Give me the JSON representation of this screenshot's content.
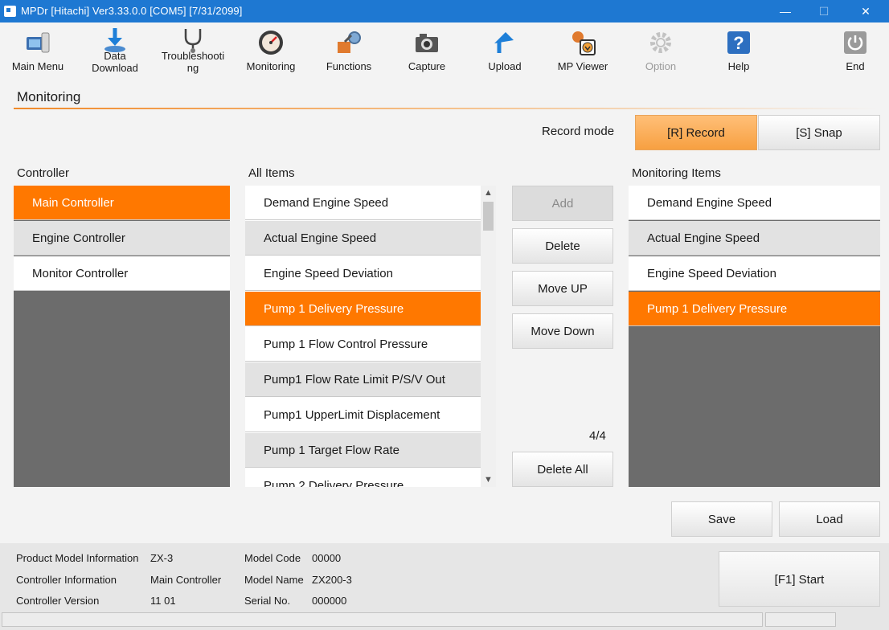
{
  "window": {
    "title": "MPDr [Hitachi]  Ver3.33.0.0 [COM5] [7/31/2099]",
    "minimize": "—",
    "maximize": "☐",
    "close": "✕"
  },
  "toolbar": {
    "items": [
      {
        "label": "Main Menu",
        "icon": "main-menu-icon"
      },
      {
        "label": "Data Download",
        "icon": "download-icon"
      },
      {
        "label": "Troubleshooting",
        "icon": "stethoscope-icon"
      },
      {
        "label": "Monitoring",
        "icon": "gauge-icon"
      },
      {
        "label": "Functions",
        "icon": "functions-icon"
      },
      {
        "label": "Capture",
        "icon": "camera-icon"
      },
      {
        "label": "Upload",
        "icon": "upload-icon"
      },
      {
        "label": "MP Viewer",
        "icon": "mp-viewer-icon"
      },
      {
        "label": "Option",
        "icon": "gear-icon",
        "disabled": true
      },
      {
        "label": "Help",
        "icon": "help-icon"
      },
      {
        "label": "End",
        "icon": "power-icon"
      }
    ]
  },
  "section_title": "Monitoring",
  "record_mode": {
    "label": "Record mode",
    "record_btn": "[R] Record",
    "snap_btn": "[S] Snap",
    "selected": "record"
  },
  "controller": {
    "header": "Controller",
    "items": [
      "Main Controller",
      "Engine Controller",
      "Monitor Controller"
    ],
    "selected_index": 0
  },
  "all_items": {
    "header": "All Items",
    "items": [
      "Demand Engine Speed",
      "Actual Engine Speed",
      "Engine Speed Deviation",
      "Pump 1 Delivery Pressure",
      "Pump 1 Flow Control Pressure",
      "Pump1 Flow Rate Limit P/S/V Out",
      "Pump1 UpperLimit Displacement",
      "Pump 1 Target Flow Rate",
      "Pump 2 Delivery Pressure"
    ],
    "selected_index": 3
  },
  "actions": {
    "add": "Add",
    "delete": "Delete",
    "move_up": "Move UP",
    "move_down": "Move Down",
    "count": "4/4",
    "delete_all": "Delete All"
  },
  "monitoring_items": {
    "header": "Monitoring Items",
    "items": [
      "Demand Engine Speed",
      "Actual Engine Speed",
      "Engine Speed Deviation",
      "Pump 1 Delivery Pressure"
    ],
    "selected_index": 3
  },
  "file_buttons": {
    "save": "Save",
    "load": "Load"
  },
  "info": {
    "product_model_label": "Product Model Information",
    "product_model_value": "ZX-3",
    "controller_info_label": "Controller Information",
    "controller_info_value": "Main Controller",
    "controller_version_label": "Controller Version",
    "controller_version_value": "11 01",
    "model_code_label": "Model Code",
    "model_code_value": "00000",
    "model_name_label": "Model Name",
    "model_name_value": "ZX200-3",
    "serial_label": "Serial No.",
    "serial_value": "000000"
  },
  "start_button": "[F1] Start",
  "colors": {
    "accent": "#ff7800",
    "titlebar": "#1e78d2",
    "list_empty": "#6c6c6c"
  }
}
